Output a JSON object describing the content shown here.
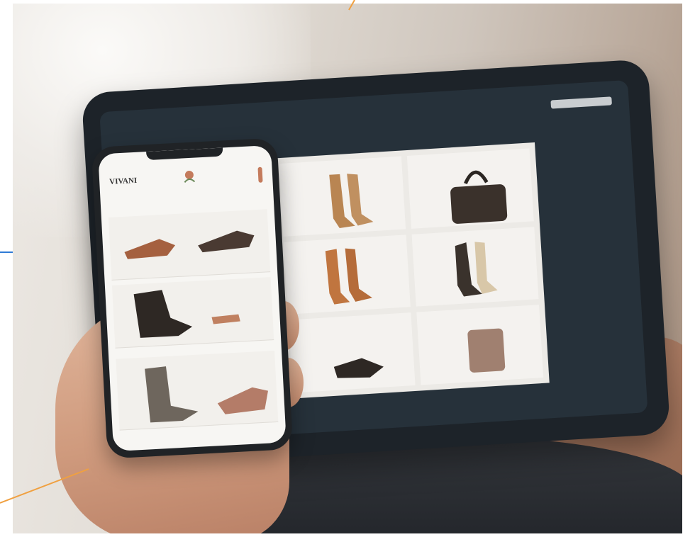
{
  "scene": {
    "description_colors": {
      "background": "#e6e1db",
      "tablet_body": "#1d2329",
      "accent_orange": "#f0a040",
      "accent_blue": "#2f7bd6"
    }
  },
  "tablet": {
    "header_title": "",
    "icon": "search-bar"
  },
  "phone": {
    "brand": "VIVANI",
    "tagline": "",
    "icon": "menu-icon"
  }
}
